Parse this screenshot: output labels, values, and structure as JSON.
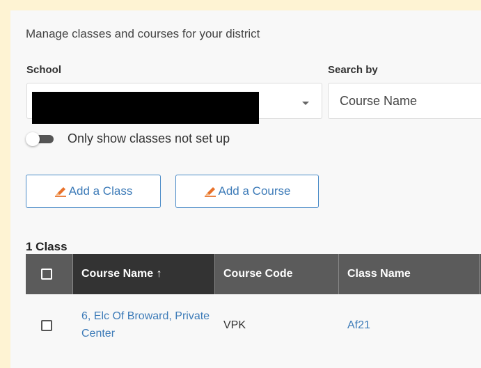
{
  "page": {
    "subtitle": "Manage classes and courses for your district"
  },
  "filters": {
    "school_label": "School",
    "search_by_label": "Search by",
    "search_by_value": "Course Name",
    "toggle_label": "Only show classes not set up"
  },
  "actions": {
    "add_class": "Add a Class",
    "add_course": "Add a Course",
    "accent_color": "#3d7bb8",
    "pencil_color": "#e8712a"
  },
  "table": {
    "count_label": "1 Class",
    "columns": [
      "Course Name ↑",
      "Course Code",
      "Class Name"
    ],
    "rows": [
      {
        "course_name": "6, Elc Of Broward, Private Center",
        "course_code": "VPK",
        "class_name": "Af21"
      }
    ]
  }
}
